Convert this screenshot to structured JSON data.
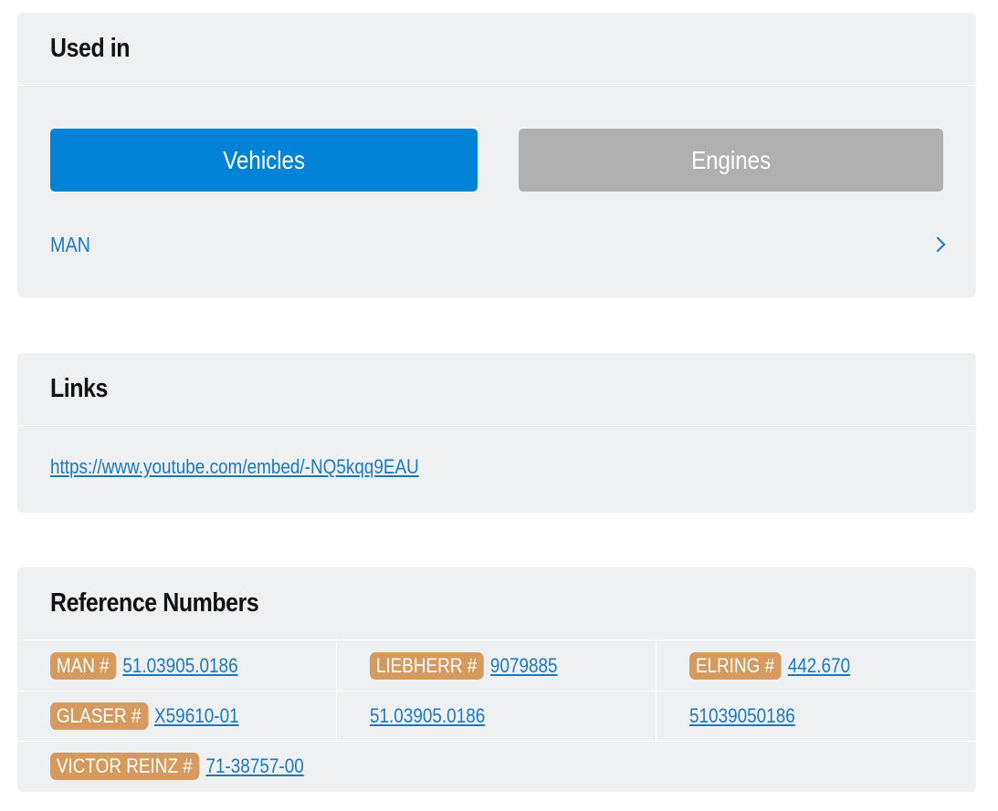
{
  "used_in": {
    "title": "Used in",
    "tabs": [
      {
        "label": "Vehicles",
        "active": true
      },
      {
        "label": "Engines",
        "active": false
      }
    ],
    "brands": [
      {
        "label": "MAN"
      }
    ]
  },
  "links": {
    "title": "Links",
    "items": [
      {
        "url": "https://www.youtube.com/embed/-NQ5kqq9EAU"
      }
    ]
  },
  "reference_numbers": {
    "title": "Reference Numbers",
    "rows": [
      [
        {
          "badge": "MAN #",
          "number": "51.03905.0186"
        },
        {
          "badge": "LIEBHERR #",
          "number": "9079885"
        },
        {
          "badge": "ELRING #",
          "number": "442.670"
        }
      ],
      [
        {
          "badge": "GLASER #",
          "number": "X59610-01"
        },
        {
          "badge": "",
          "number": "51.03905.0186"
        },
        {
          "badge": "",
          "number": "51039050186"
        }
      ],
      [
        {
          "badge": "VICTOR REINZ #",
          "number": "71-38757-00"
        }
      ]
    ]
  },
  "colors": {
    "card_bg": "#eff0f2",
    "accent_blue": "#0082d6",
    "inactive_tab": "#b0b0b0",
    "link": "#1a78c2",
    "badge": "#d69a5e"
  },
  "icons": {
    "brand_row_arrow": "chevron-right-icon"
  }
}
